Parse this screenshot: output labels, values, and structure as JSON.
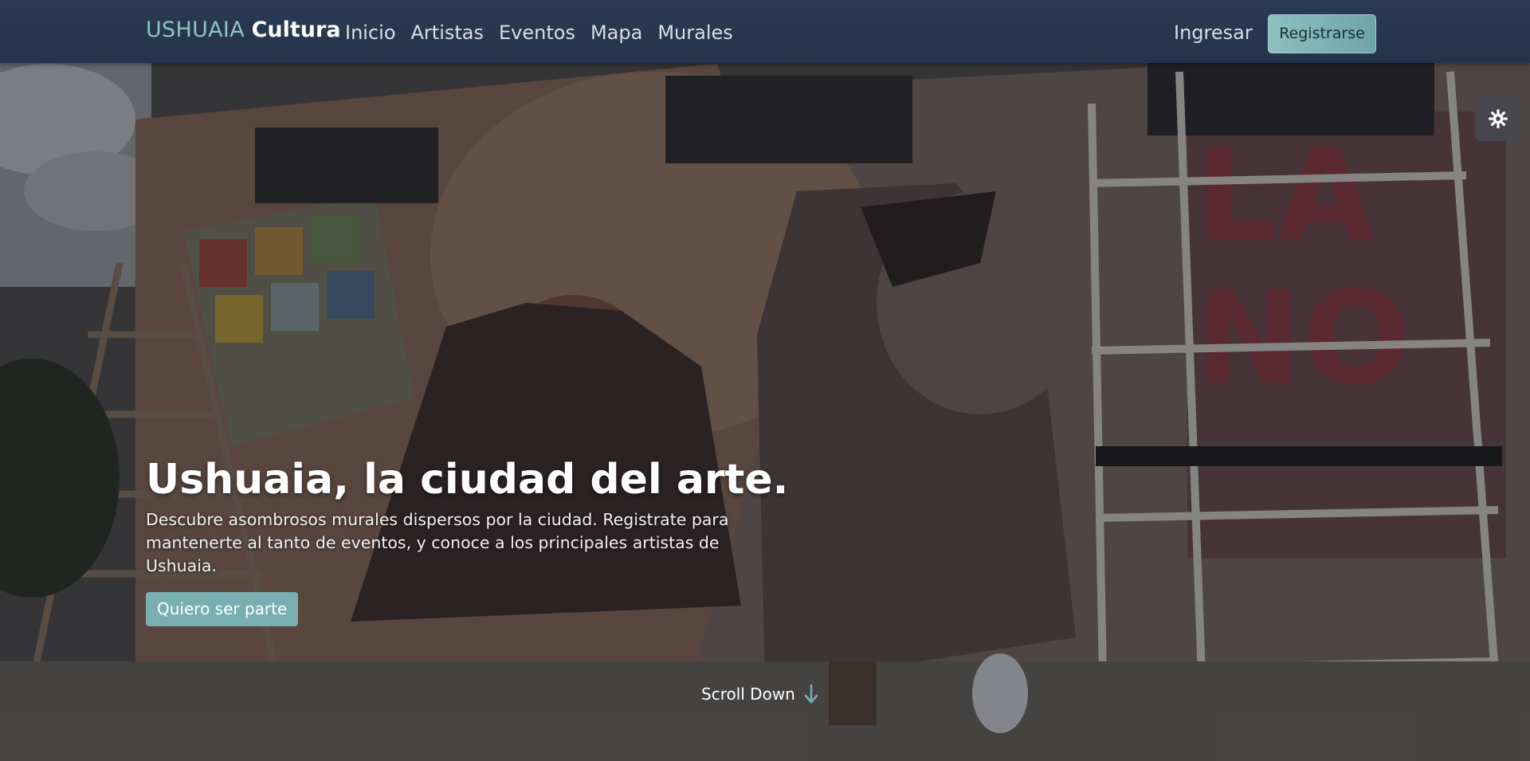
{
  "navbar": {
    "brand_primary": "USHUAIA",
    "brand_secondary": "Cultura",
    "links": [
      {
        "label": "Inicio"
      },
      {
        "label": "Artistas"
      },
      {
        "label": "Eventos"
      },
      {
        "label": "Mapa"
      },
      {
        "label": "Murales"
      }
    ],
    "login_label": "Ingresar",
    "register_label": "Registrarse"
  },
  "theme_toggle": {
    "icon": "gear-icon"
  },
  "hero": {
    "title": "Ushuaia, la ciudad del arte.",
    "subtitle": "Descubre asombrosos murales dispersos por la ciudad. Registrate para mantenerte al tanto de eventos, y conoce a los principales artistas de Ushuaia.",
    "cta_label": "Quiero ser parte",
    "scroll_label": "Scroll Down",
    "scroll_icon": "arrow-down-icon"
  },
  "colors": {
    "nav_bg": "#263650",
    "accent": "#79aeb2",
    "brand_accent": "#8fc3c4"
  }
}
